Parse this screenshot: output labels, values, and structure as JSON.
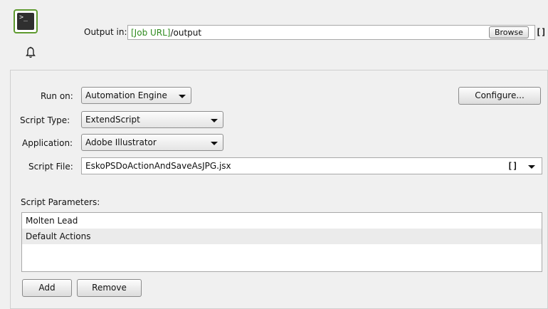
{
  "top": {
    "output_label": "Output in:",
    "output_token": "[Job URL]",
    "output_rest": "/output",
    "browse_label": "Browse",
    "bracket_label": "[]"
  },
  "form": {
    "run_on_label": "Run on:",
    "run_on_value": "Automation Engine",
    "configure_label": "Configure...",
    "script_type_label": "Script Type:",
    "script_type_value": "ExtendScript",
    "application_label": "Application:",
    "application_value": "Adobe Illustrator",
    "script_file_label": "Script File:",
    "script_file_value": "EskoPSDoActionAndSaveAsJPG.jsx",
    "script_file_bracket": "[]"
  },
  "params": {
    "label": "Script Parameters:",
    "items": [
      "Molten Lead",
      "Default Actions"
    ],
    "add_label": "Add",
    "remove_label": "Remove"
  },
  "icons": {
    "terminal": "terminal-icon",
    "bell": "bell-icon",
    "dropdown": "chevron-down-icon"
  },
  "colors": {
    "token_green": "#2e8b1e",
    "icon_border": "#5e9a2f",
    "background": "#f0f0f0"
  }
}
